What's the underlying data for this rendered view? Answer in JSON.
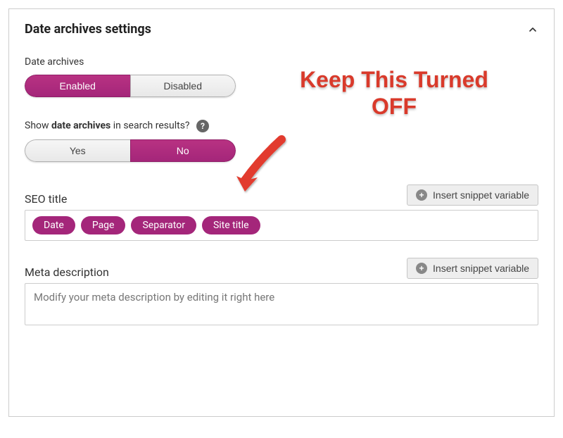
{
  "panel": {
    "title": "Date archives settings"
  },
  "dateArchives": {
    "label": "Date archives",
    "enabled": "Enabled",
    "disabled": "Disabled"
  },
  "showInSearch": {
    "prefix": "Show ",
    "bold": "date archives",
    "suffix": " in search results?",
    "yes": "Yes",
    "no": "No"
  },
  "seoTitle": {
    "label": "SEO title",
    "insertBtn": "Insert snippet variable",
    "pills": [
      "Date",
      "Page",
      "Separator",
      "Site title"
    ]
  },
  "metaDesc": {
    "label": "Meta description",
    "insertBtn": "Insert snippet variable",
    "placeholder": "Modify your meta description by editing it right here"
  },
  "annotation": {
    "line1": "Keep This Turned",
    "line2": "OFF"
  }
}
